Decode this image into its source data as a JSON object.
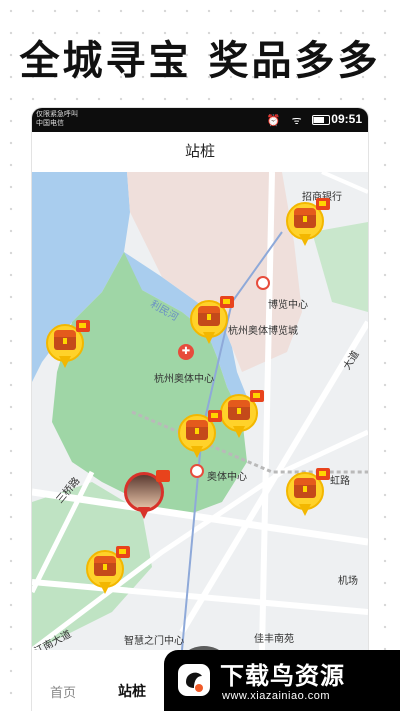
{
  "headline": "全城寻宝   奖品多多",
  "status_bar": {
    "left_line1": "仅限紧急呼叫",
    "left_line2": "中国电信",
    "icons": "⏰ ᯤ ✉",
    "time": "09:51"
  },
  "nav": {
    "title": "站桩"
  },
  "map": {
    "labels": {
      "zhaoshang": "招商银行",
      "bolan_center": "博览中心",
      "aoti_bolancheng": "杭州奥体博览城",
      "liminhe": "利民河",
      "aoti_center": "杭州奥体中心",
      "aoti_center_station": "奥体中心",
      "hong": "虹路",
      "sanqiao": "三桥路",
      "jichang": "机场",
      "zhihui": "智慧之门中心",
      "jiafeng": "佳丰南苑",
      "jiang": "江南大道",
      "dadao": "大道"
    }
  },
  "tabs": [
    {
      "label": "首页"
    },
    {
      "label": "站桩"
    }
  ],
  "watermark": {
    "title": "下载鸟资源",
    "url": "www.xiazainiao.com"
  },
  "colors": {
    "pin_yellow": "#ffd22a",
    "pin_red": "#e8431c",
    "river": "#a9cdee",
    "park": "#9fd6a6",
    "zone": "#efdfdb"
  }
}
